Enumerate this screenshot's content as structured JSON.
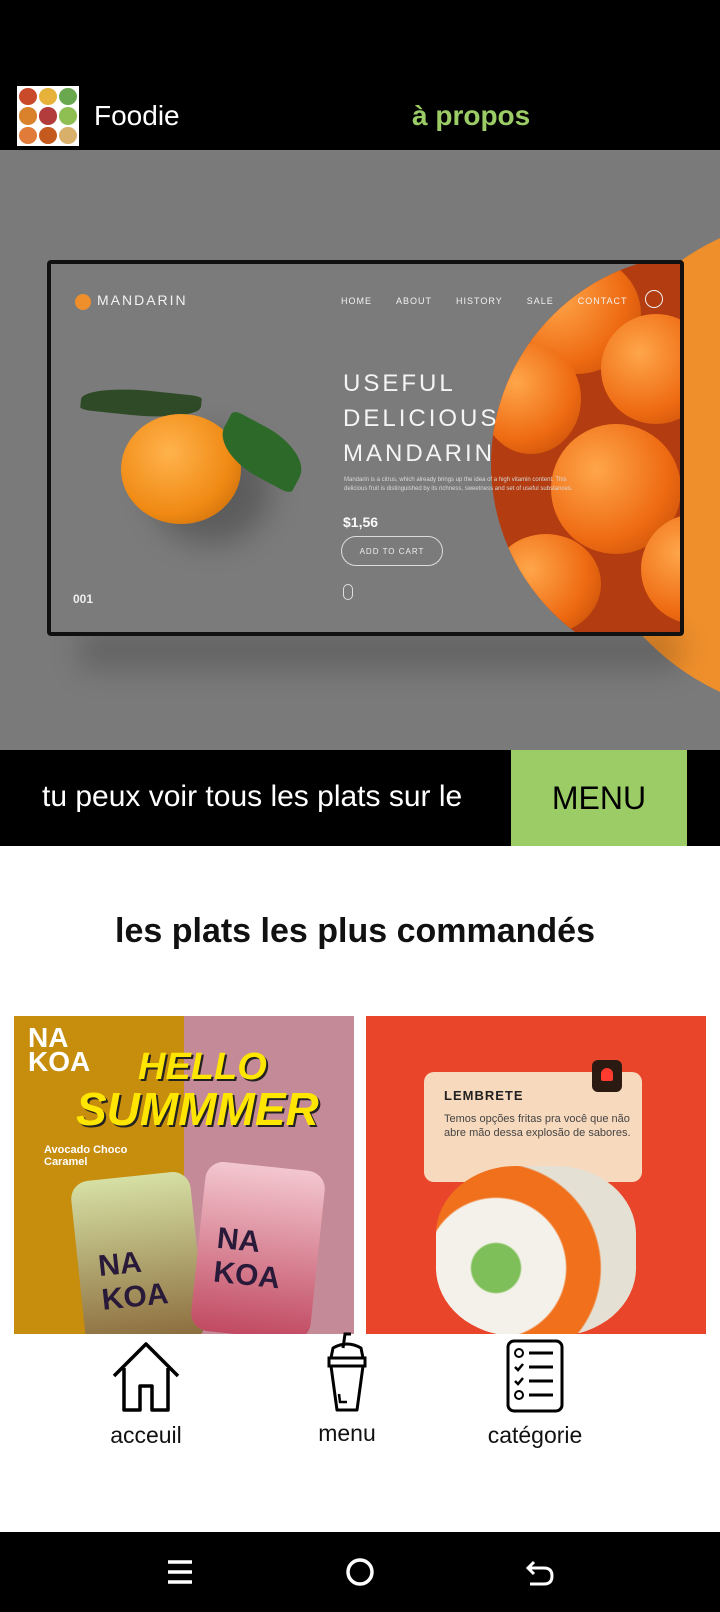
{
  "app": {
    "title": "Foodie",
    "about_link": "à propos"
  },
  "hero": {
    "mockup": {
      "brand": "MANDARIN",
      "nav": [
        "HOME",
        "ABOUT",
        "HISTORY",
        "SALE",
        "CONTACT"
      ],
      "headline": [
        "USEFUL",
        "DELICIOUS",
        "MANDARIN"
      ],
      "description": "Mandarin is a citrus, which already brings up the idea of a high vitamin content. This delicious fruit is distinguished by its richness, sweetness and set of useful substances.",
      "price": "$1,56",
      "cta": "ADD TO CART",
      "slide_number": "001"
    }
  },
  "promo": {
    "text": "tu peux voir tous les plats sur le",
    "button_label": "MENU"
  },
  "section": {
    "title": "les plats les plus commandés"
  },
  "cards": [
    {
      "brand_line1": "NA",
      "brand_line2": "KOA",
      "headline1": "HELLO",
      "headline2": "SUMMMER",
      "flavor": "Avocado Choco Caramel",
      "cup_label": "NA KOA"
    },
    {
      "title": "LEMBRETE",
      "body": "Temos opções fritas pra você que não abre mão dessa explosão de sabores."
    }
  ],
  "bottom_nav": [
    {
      "label": "acceuil",
      "icon": "home-icon"
    },
    {
      "label": "menu",
      "icon": "drink-cup-icon"
    },
    {
      "label": "catégorie",
      "icon": "checklist-icon"
    }
  ],
  "system_nav": {
    "icons": [
      "recent-apps-icon",
      "home-circle-icon",
      "back-icon"
    ]
  },
  "colors": {
    "accent": "#9ccc65",
    "dark": "#000000",
    "hero_bg": "#7a7a7a",
    "orange": "#ef8f2c"
  }
}
